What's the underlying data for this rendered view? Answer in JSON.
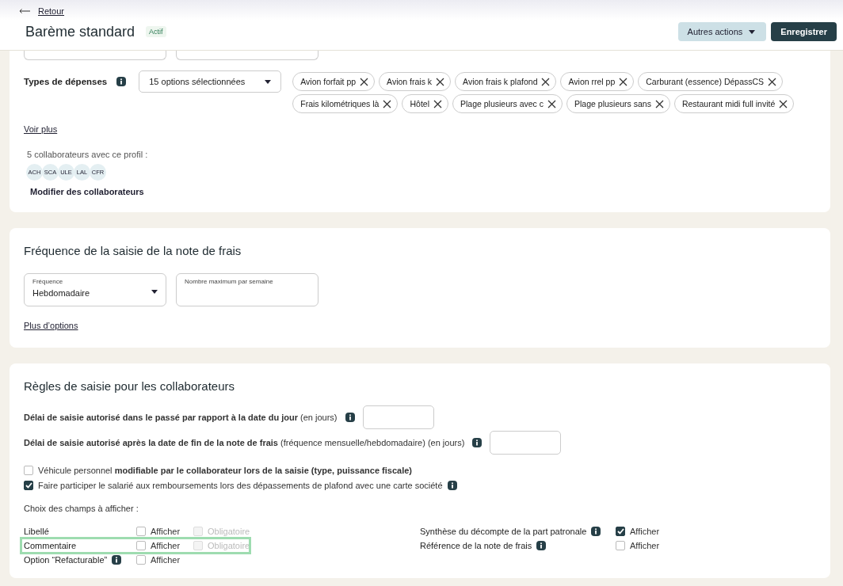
{
  "header": {
    "back_link": "Retour",
    "title": "Barème standard",
    "status": "Actif",
    "buttons": [
      {
        "label": "Autres actions",
        "kind": "dropdown"
      },
      {
        "label": "Enregistrer",
        "kind": "primary"
      }
    ]
  },
  "profile_card": {
    "expense_types": {
      "label": "Types de dépenses",
      "select_value": "15 options sélectionnées",
      "tags": [
        "Avion forfait pp",
        "Avion frais k",
        "Avion frais k plafond",
        "Avion rrel pp",
        "Carburant (essence) DépassCS",
        "Frais kilométriques là",
        "Hôtel",
        "Plage plusieurs avec c",
        "Plage plusieurs sans",
        "Restaurant midi full invité"
      ]
    },
    "see_more": "Voir plus",
    "collaborators_text": "5 collaborateurs avec ce profil :",
    "avatars": [
      "ACH",
      "SCA",
      "ULE",
      "LAL",
      "CFR"
    ],
    "modify_link": "Modifier des collaborateurs"
  },
  "frequency_card": {
    "title": "Fréquence de la saisie de la note de frais",
    "fields": [
      {
        "kind": "select",
        "label": "Fréquence",
        "value": "Hebdomadaire"
      },
      {
        "kind": "input",
        "label": "Nombre maximum par semaine"
      }
    ],
    "more_options": "Plus d’options"
  },
  "rules_card": {
    "title": "Règles de saisie pour les collaborateurs",
    "delay_fields": [
      {
        "text": "**Délai de saisie autorisé dans le passé par rapport à la date du jour** (en jours)"
      },
      {
        "text": "**Délai de saisie autorisé après la date de fin de la note de frais** (fréquence mensuelle/hebdomadaire) (en jours)"
      }
    ],
    "options": [
      {
        "text": "Véhicule personnel **modifiable par le collaborateur lors de la saisie (type, puissance fiscale)**",
        "checked": false,
        "info": false
      },
      {
        "text": "Faire participer le salarié aux remboursements lors des dépassements de plafond avec une carte société",
        "checked": true,
        "info": true
      }
    ],
    "fields_heading": "Choix des champs à afficher :",
    "fields_left": [
      {
        "label": "Libellé",
        "info": false,
        "highlighted": false,
        "show": {
          "label": "Afficher",
          "checked": false
        },
        "required": {
          "label": "Obligatoire",
          "checked": false,
          "disabled": true
        }
      },
      {
        "label": "Commentaire",
        "info": false,
        "highlighted": true,
        "show": {
          "label": "Afficher",
          "checked": false
        },
        "required": {
          "label": "Obligatoire",
          "checked": false,
          "disabled": true
        }
      },
      {
        "label": "Option “Refacturable”",
        "info": true,
        "highlighted": false,
        "show": {
          "label": "Afficher",
          "checked": false
        }
      }
    ],
    "fields_right": [
      {
        "label": "Synthèse du décompte de la part patronale",
        "info": true,
        "show": {
          "label": "Afficher",
          "checked": true
        }
      },
      {
        "label": "Référence de la note de frais",
        "info": true,
        "show": {
          "label": "Afficher",
          "checked": false
        }
      }
    ]
  }
}
